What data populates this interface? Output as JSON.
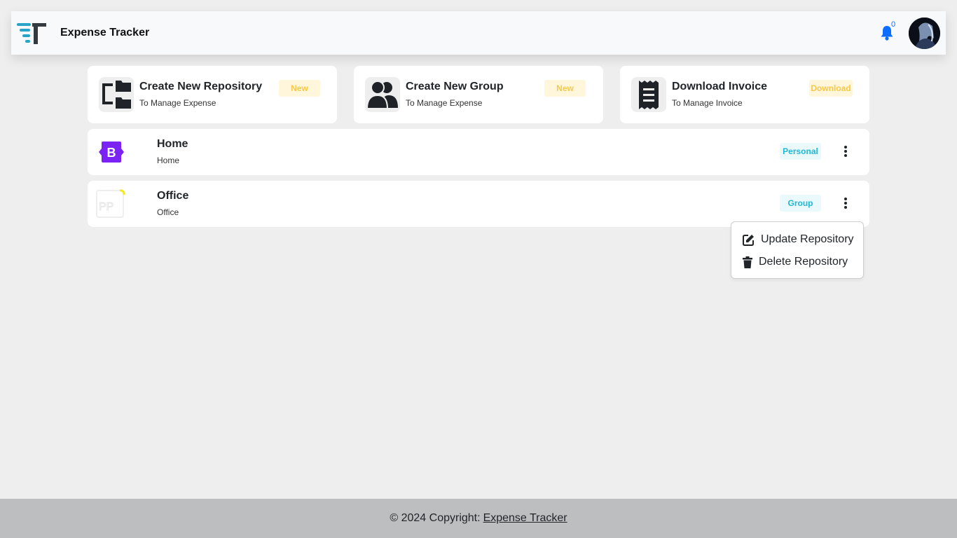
{
  "header": {
    "app_name": "Expense Tracker",
    "notification_count": "0",
    "icons": {
      "logo": "expense-tracker-logo",
      "bell": "bell-icon",
      "avatar": "avatar"
    },
    "colors": {
      "accent": "#0d6efd",
      "logo_blue": "#2aa3c9",
      "logo_dark": "#333a40"
    }
  },
  "actions": [
    {
      "title": "Create New Repository",
      "subtitle": "To Manage Expense",
      "badge": "New",
      "icon": "repository-folder-icon"
    },
    {
      "title": "Create New Group",
      "subtitle": "To Manage Expense",
      "badge": "New",
      "icon": "users-group-icon"
    },
    {
      "title": "Download Invoice",
      "subtitle": "To Manage Invoice",
      "badge": "Download",
      "icon": "receipt-icon"
    }
  ],
  "repositories": [
    {
      "name": "Home",
      "description": "Home",
      "badge": "Personal",
      "logo": "bootstrap-logo-icon",
      "logo_color": "#7b22f5"
    },
    {
      "name": "Office",
      "description": "Office",
      "badge": "Group",
      "logo": "office-logo-icon",
      "logo_color": "#f5ea16"
    }
  ],
  "dropdown": {
    "items": [
      {
        "label": "Update Repository",
        "icon": "edit-icon"
      },
      {
        "label": "Delete Repository",
        "icon": "trash-icon"
      }
    ]
  },
  "footer": {
    "copyright": "© 2024 Copyright:",
    "link": "Expense Tracker"
  }
}
